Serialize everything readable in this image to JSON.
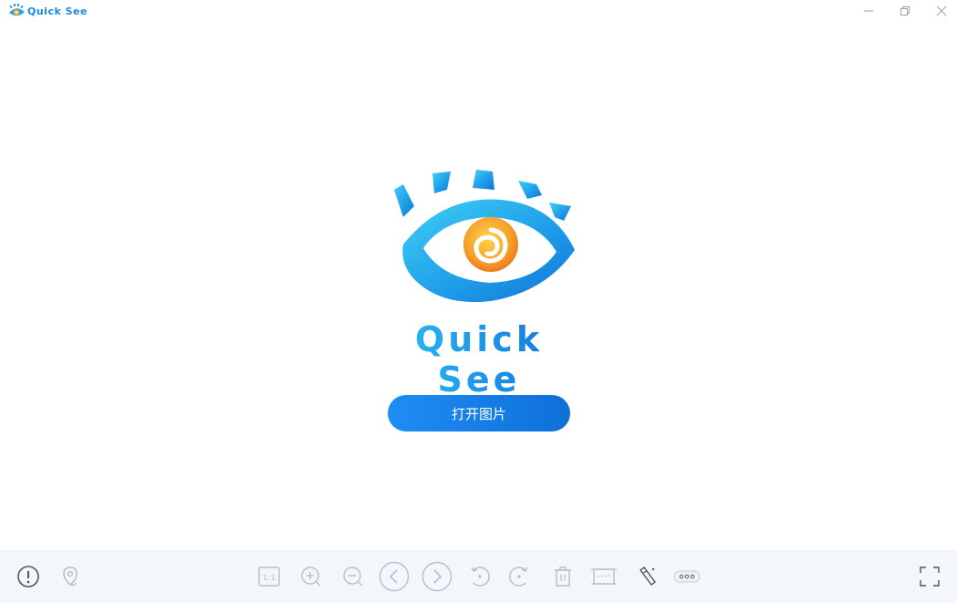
{
  "window": {
    "app_name": "Quick See",
    "minimize_icon": "minimize-icon",
    "maximize_icon": "restore-icon",
    "close_icon": "close-icon"
  },
  "main": {
    "brand_name": "Quick See",
    "open_button_label": "打开图片",
    "logo_icon": "eye-logo-icon"
  },
  "toolbar": {
    "left": [
      {
        "name": "info-button",
        "icon": "info-icon"
      },
      {
        "name": "location-button",
        "icon": "location-pin-icon"
      }
    ],
    "center": [
      {
        "name": "actual-size-button",
        "icon": "actual-size-icon",
        "label": "1:1"
      },
      {
        "name": "zoom-in-button",
        "icon": "zoom-in-icon"
      },
      {
        "name": "zoom-out-button",
        "icon": "zoom-out-icon"
      },
      {
        "name": "previous-button",
        "icon": "chevron-left-icon"
      },
      {
        "name": "next-button",
        "icon": "chevron-right-icon"
      },
      {
        "name": "rotate-left-button",
        "icon": "rotate-left-icon"
      },
      {
        "name": "rotate-right-button",
        "icon": "rotate-right-icon"
      },
      {
        "name": "delete-button",
        "icon": "trash-icon"
      },
      {
        "name": "crop-button",
        "icon": "crop-icon"
      },
      {
        "name": "edit-button",
        "icon": "edit-icon"
      },
      {
        "name": "more-button",
        "icon": "more-icon"
      }
    ],
    "right": [
      {
        "name": "fullscreen-button",
        "icon": "fullscreen-icon"
      }
    ]
  },
  "colors": {
    "accent": "#1a8be0",
    "button_start": "#1e8ef4",
    "button_end": "#0f6fd9",
    "toolbar_bg": "#f3f7fb",
    "icon_gray": "#b9bec6"
  }
}
